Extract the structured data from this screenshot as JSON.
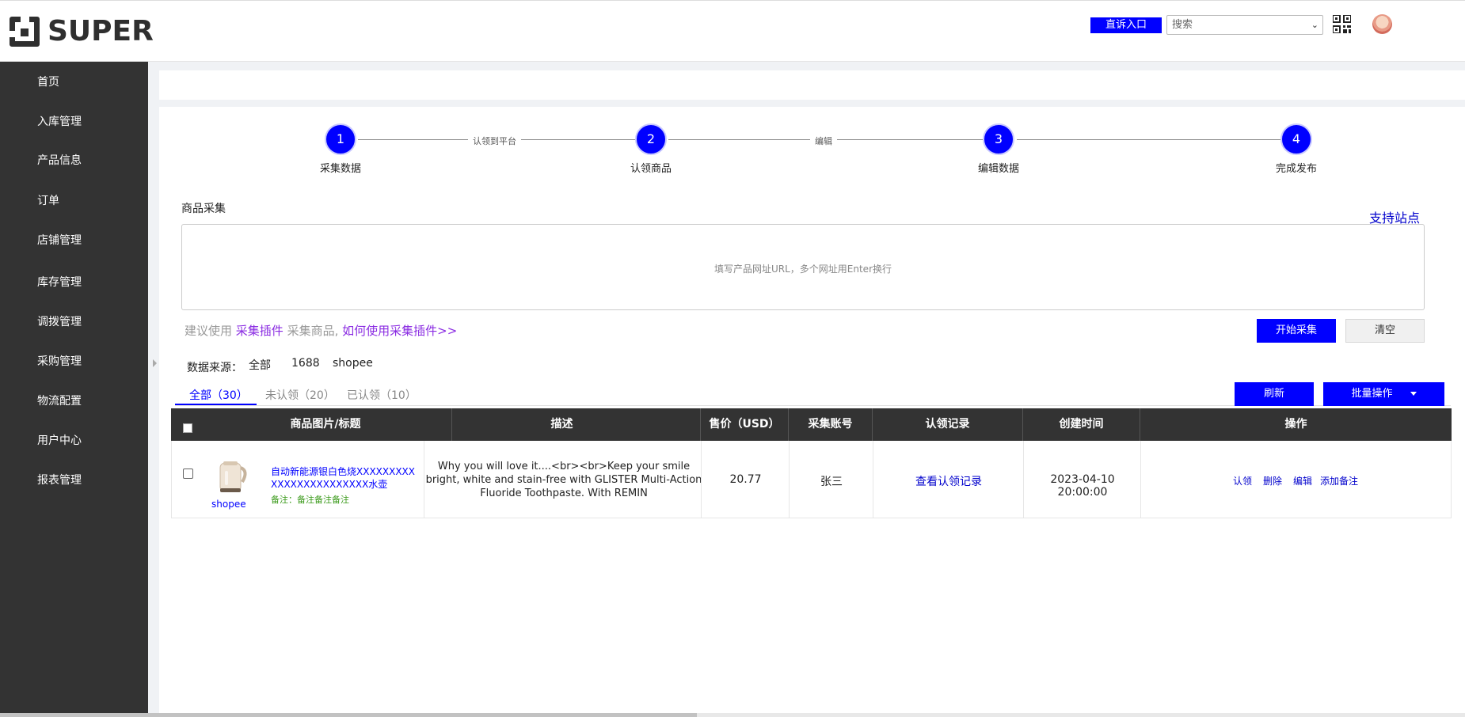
{
  "brand": {
    "logo_text": "SUPER"
  },
  "header": {
    "complain_label": "直诉入口",
    "search_placeholder": "搜索",
    "qr_icon": "qr-code-icon",
    "avatar_icon": "user-avatar"
  },
  "sidebar": {
    "items": [
      {
        "label": "首页"
      },
      {
        "label": "入库管理"
      },
      {
        "label": "产品信息"
      },
      {
        "label": "订单"
      },
      {
        "label": "店铺管理"
      },
      {
        "label": "库存管理"
      },
      {
        "label": "调拨管理"
      },
      {
        "label": "采购管理"
      },
      {
        "label": "物流配置"
      },
      {
        "label": "用户中心"
      },
      {
        "label": "报表管理"
      }
    ]
  },
  "steps": {
    "items": [
      {
        "number": "1",
        "label": "采集数据"
      },
      {
        "number": "2",
        "label": "认领商品"
      },
      {
        "number": "3",
        "label": "编辑数据"
      },
      {
        "number": "4",
        "label": "完成发布"
      }
    ],
    "connectors": [
      "认领到平台",
      "编辑"
    ]
  },
  "collect": {
    "section_label": "商品采集",
    "support_link": "支持站点",
    "url_placeholder": "填写产品网址URL，多个网址用Enter换行",
    "hint_prefix": "建议使用",
    "hint_plugin": "采集插件",
    "hint_middle": "采集商品,",
    "hint_howto": "如何使用采集插件>>",
    "start_label": "开始采集",
    "clear_label": "清空"
  },
  "source": {
    "label": "数据来源：",
    "options": [
      "全部",
      "1688",
      "shopee"
    ]
  },
  "tabs": {
    "items": [
      {
        "label": "全部（30）"
      },
      {
        "label": "未认领（20）"
      },
      {
        "label": "已认领（10）"
      }
    ]
  },
  "actions": {
    "refresh_label": "刷新",
    "batch_label": "批量操作"
  },
  "table": {
    "columns": [
      "商品图片/标题",
      "描述",
      "售价（USD）",
      "采集账号",
      "认领记录",
      "创建时间",
      "操作"
    ],
    "rows": [
      {
        "source": "shopee",
        "title": "自动新能源银白色烧XXXXXXXXXXXXXXXXXXXXXXXX水壶",
        "note": "备注：备注备注备注",
        "description": "Why you will love it....<br><br>Keep your smile bright, white and stain-free with GLISTER Multi-Action Fluoride Toothpaste. With REMIN",
        "price": "20.77",
        "account": "张三",
        "record_link": "查看认领记录",
        "created": "2023-04-10 20:00:00",
        "ops": [
          "认领",
          "删除",
          "编辑",
          "添加备注"
        ]
      }
    ]
  },
  "colors": {
    "primary": "#0000ff",
    "sidebar_bg": "#333333",
    "header_table_bg": "#333333",
    "note_green": "#3a9a1a"
  }
}
